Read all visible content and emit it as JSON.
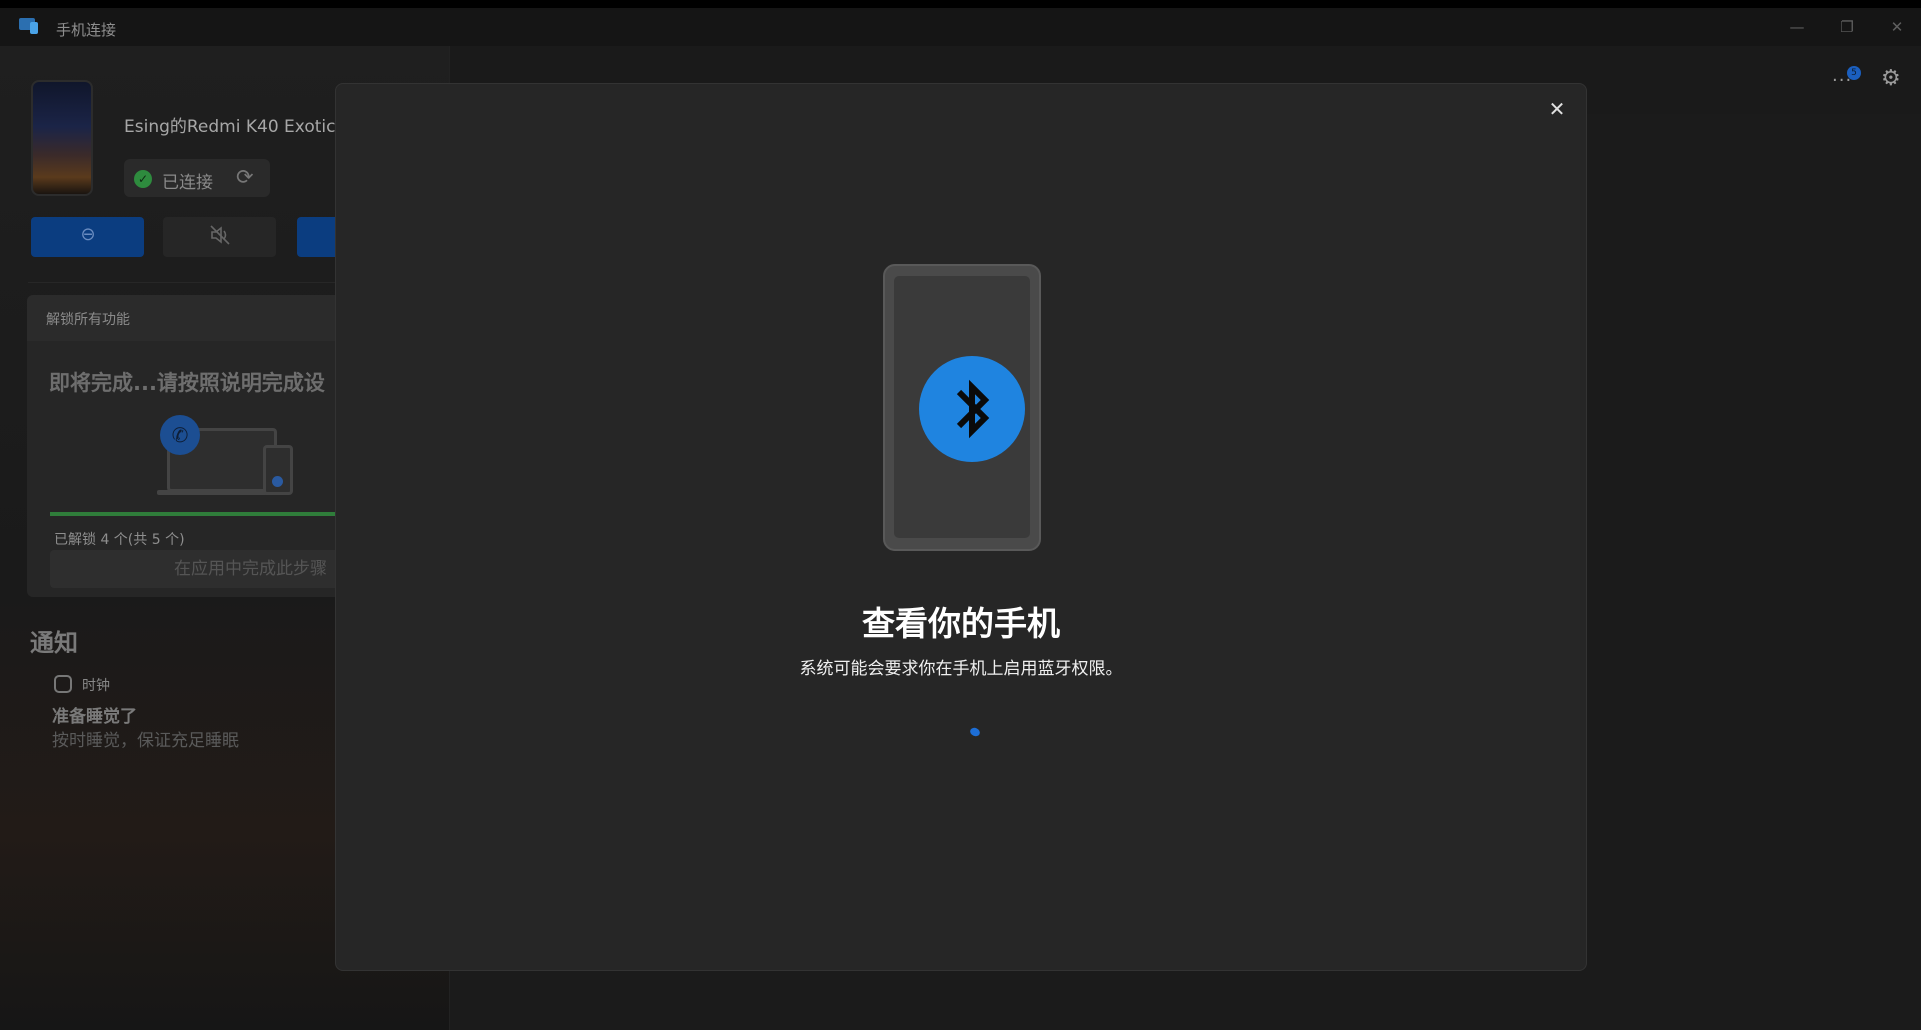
{
  "window": {
    "title": "手机连接",
    "controls": {
      "minimize": "—",
      "maximize": "❐",
      "close": "✕"
    }
  },
  "device": {
    "name": "Esing的Redmi K40 Exotic",
    "status": "已连接"
  },
  "quick_actions": {
    "dnd_icon": "⊖",
    "mute_icon": "🔇"
  },
  "unlock": {
    "header": "解锁所有功能",
    "title": "即将完成...请按照说明完成设",
    "progress_text": "已解锁 4 个(共 5 个)",
    "progress_fraction": 0.8,
    "button": "在应用中完成此步骤"
  },
  "notifications": {
    "heading": "通知",
    "items": [
      {
        "app": "时钟",
        "title": "准备睡觉了",
        "body": "按时睡觉，保证充足睡眠"
      }
    ]
  },
  "header": {
    "more_icon": "···",
    "badge": "5",
    "settings_icon": "⚙"
  },
  "modal": {
    "close_icon": "✕",
    "title": "查看你的手机",
    "subtitle": "系统可能会要求你在手机上启用蓝牙权限。",
    "icon": "bluetooth-icon"
  },
  "colors": {
    "accent": "#1f84e0",
    "connected": "#2e8b3e",
    "modal_bg": "#262626"
  }
}
